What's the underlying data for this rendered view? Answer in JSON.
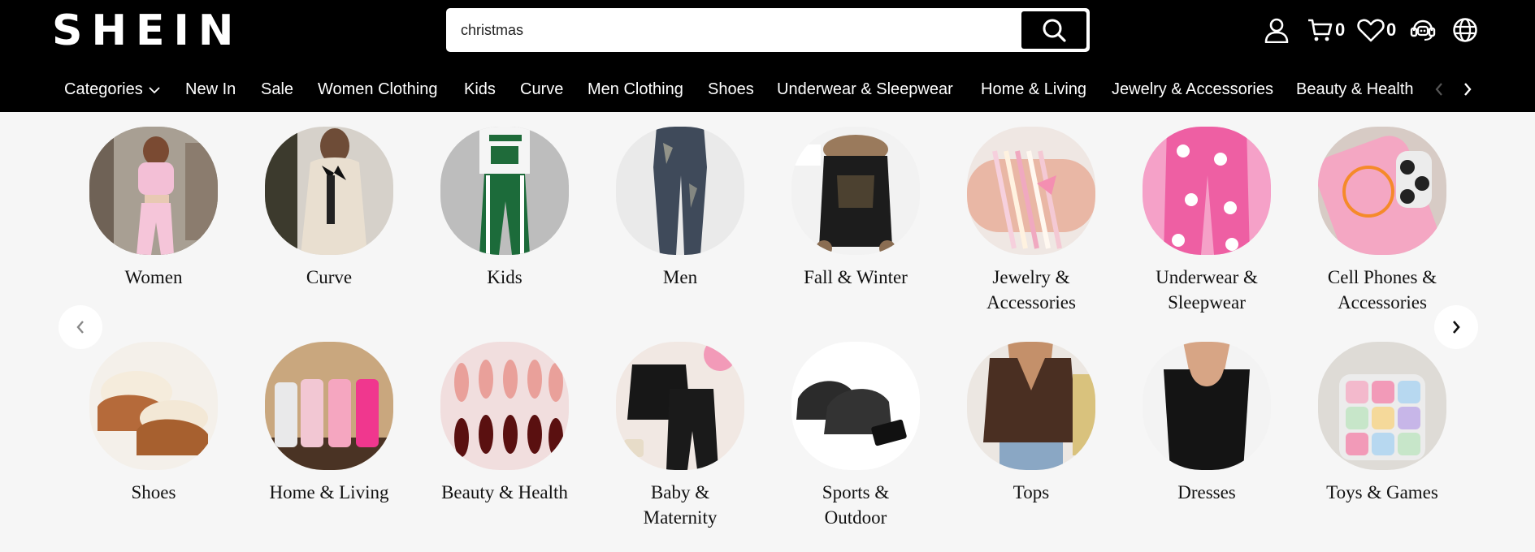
{
  "brand": {
    "logo_text": "SHEIN"
  },
  "search": {
    "value": "christmas"
  },
  "header": {
    "cart_count": "0",
    "wishlist_count": "0"
  },
  "nav": {
    "categories_label": "Categories",
    "items": [
      "New In",
      "Sale",
      "Women Clothing",
      "Kids",
      "Curve",
      "Men Clothing",
      "Shoes",
      "Underwear & Sleepwear",
      "Home & Living",
      "Jewelry & Accessories",
      "Beauty & Health"
    ]
  },
  "categories": {
    "row1": [
      {
        "line1": "Women",
        "line2": ""
      },
      {
        "line1": "Curve",
        "line2": ""
      },
      {
        "line1": "Kids",
        "line2": ""
      },
      {
        "line1": "Men",
        "line2": ""
      },
      {
        "line1": "Fall & Winter",
        "line2": ""
      },
      {
        "line1": "Jewelry &",
        "line2": "Accessories"
      },
      {
        "line1": "Underwear &",
        "line2": "Sleepwear"
      },
      {
        "line1": "Cell Phones &",
        "line2": "Accessories"
      }
    ],
    "row2": [
      {
        "line1": "Shoes",
        "line2": ""
      },
      {
        "line1": "Home & Living",
        "line2": ""
      },
      {
        "line1": "Beauty & Health",
        "line2": ""
      },
      {
        "line1": "Baby &",
        "line2": "Maternity"
      },
      {
        "line1": "Sports &",
        "line2": "Outdoor"
      },
      {
        "line1": "Tops",
        "line2": ""
      },
      {
        "line1": "Dresses",
        "line2": ""
      },
      {
        "line1": "Toys & Games",
        "line2": ""
      }
    ]
  },
  "colors": {
    "header_bg": "#000000",
    "page_bg": "#f6f6f6",
    "text_light": "#ffffff"
  }
}
